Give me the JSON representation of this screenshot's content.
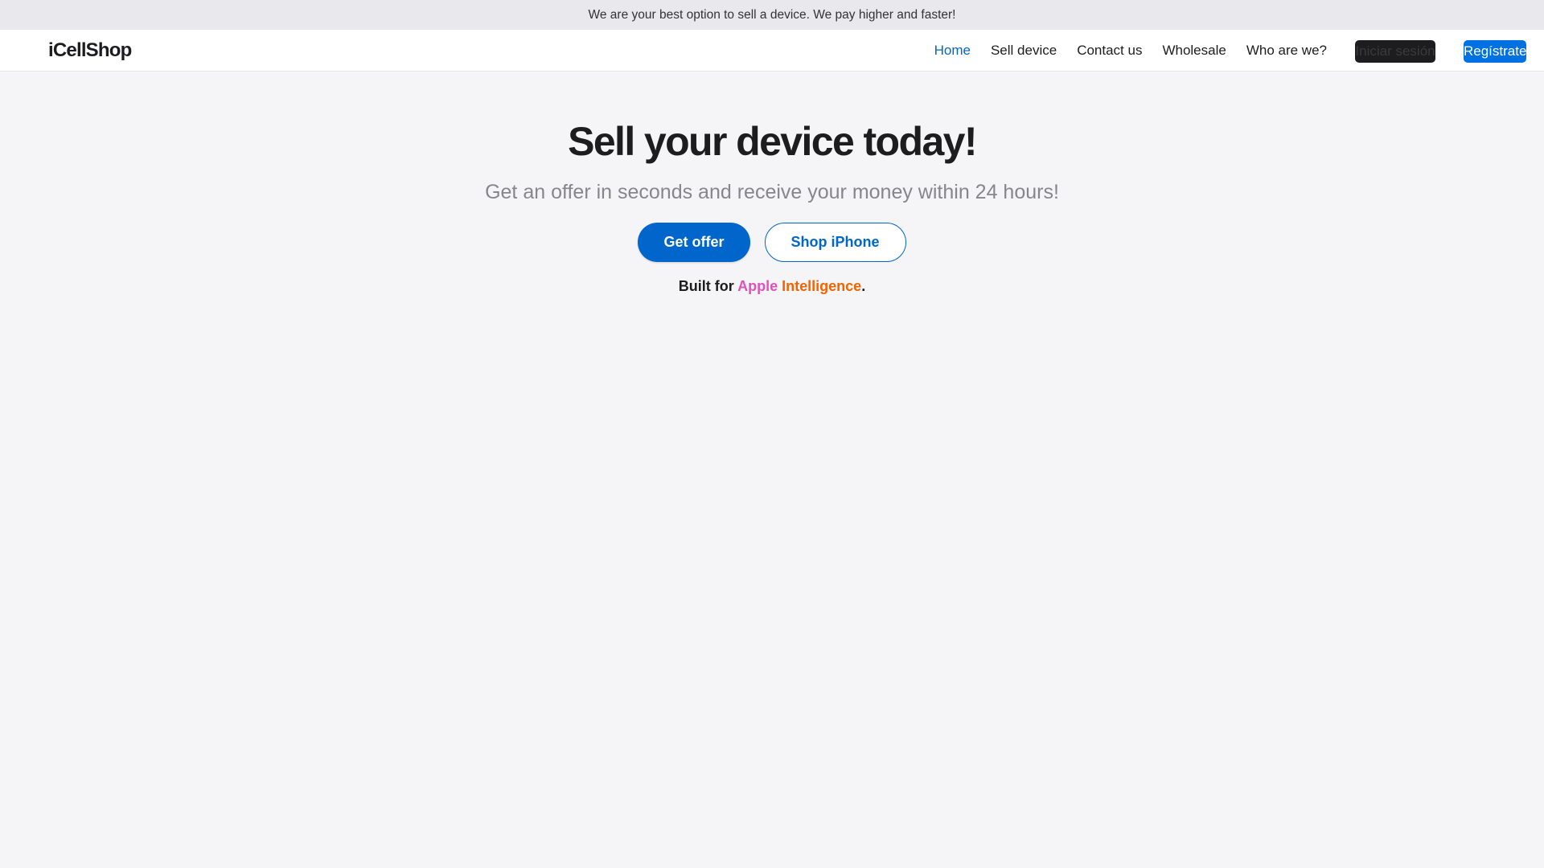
{
  "announcement": {
    "text": "We are your best option to sell a device. We pay higher and faster!"
  },
  "navbar": {
    "logo": "iCellShop",
    "links": [
      {
        "label": "Home",
        "active": true
      },
      {
        "label": "Sell device",
        "active": false
      },
      {
        "label": "Contact us",
        "active": false
      },
      {
        "label": "Wholesale",
        "active": false
      },
      {
        "label": "Who are we?",
        "active": false
      }
    ],
    "login_label": "Iniciar sesión",
    "register_label": "Regístrate"
  },
  "hero": {
    "title": "Sell your device today!",
    "subtitle": "Get an offer in seconds and receive your money within 24 hours!",
    "primary_cta": "Get offer",
    "secondary_cta": "Shop iPhone",
    "built_for_prefix": "Built for",
    "built_for_apple": "Apple",
    "built_for_intelligence": "Intelligence",
    "built_for_suffix": "."
  },
  "colors": {
    "accent": "#0066cc",
    "page_background": "#f5f5f7",
    "apple_gradient_start": "#e052b7",
    "apple_gradient_end": "#f56300"
  }
}
